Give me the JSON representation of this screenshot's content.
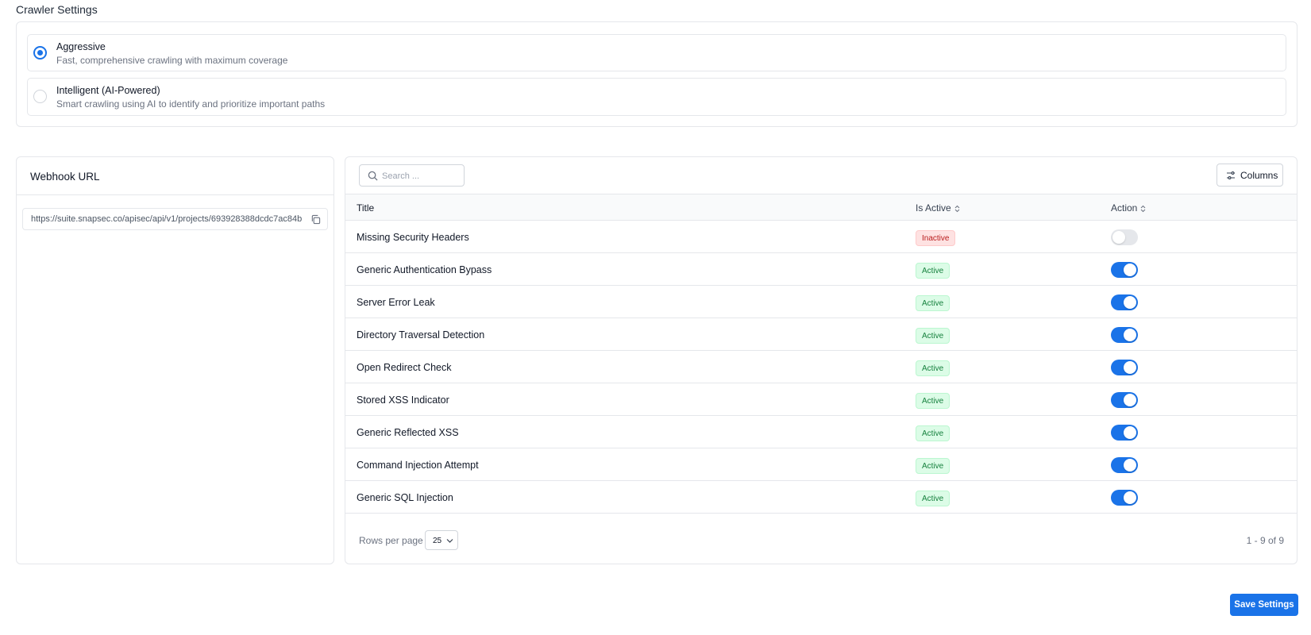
{
  "crawler": {
    "title": "Crawler Settings",
    "options": [
      {
        "label": "Aggressive",
        "description": "Fast, comprehensive crawling with maximum coverage",
        "selected": true
      },
      {
        "label": "Intelligent (AI-Powered)",
        "description": "Smart crawling using AI to identify and prioritize important paths",
        "selected": false
      }
    ]
  },
  "webhook": {
    "title": "Webhook URL",
    "url": "https://suite.snapsec.co/apisec/api/v1/projects/693928388dcdc7ac84b",
    "copy_icon": "copy-icon"
  },
  "table": {
    "search_placeholder": "Search ...",
    "columns_label": "Columns",
    "headers": {
      "title": "Title",
      "is_active": "Is Active",
      "action": "Action"
    },
    "rows": [
      {
        "title": "Missing Security Headers",
        "status": "Inactive",
        "enabled": false
      },
      {
        "title": "Generic Authentication Bypass",
        "status": "Active",
        "enabled": true
      },
      {
        "title": "Server Error Leak",
        "status": "Active",
        "enabled": true
      },
      {
        "title": "Directory Traversal Detection",
        "status": "Active",
        "enabled": true
      },
      {
        "title": "Open Redirect Check",
        "status": "Active",
        "enabled": true
      },
      {
        "title": "Stored XSS Indicator",
        "status": "Active",
        "enabled": true
      },
      {
        "title": "Generic Reflected XSS",
        "status": "Active",
        "enabled": true
      },
      {
        "title": "Command Injection Attempt",
        "status": "Active",
        "enabled": true
      },
      {
        "title": "Generic SQL Injection",
        "status": "Active",
        "enabled": true
      }
    ],
    "rows_per_page_label": "Rows per page",
    "rows_per_page_value": "25",
    "pagination": "1 - 9 of 9"
  },
  "save_label": "Save Settings",
  "colors": {
    "accent": "#1a73e8",
    "active_bg": "#dcfce7",
    "active_text": "#15803d",
    "inactive_bg": "#fee2e2",
    "inactive_text": "#b91c1c"
  }
}
